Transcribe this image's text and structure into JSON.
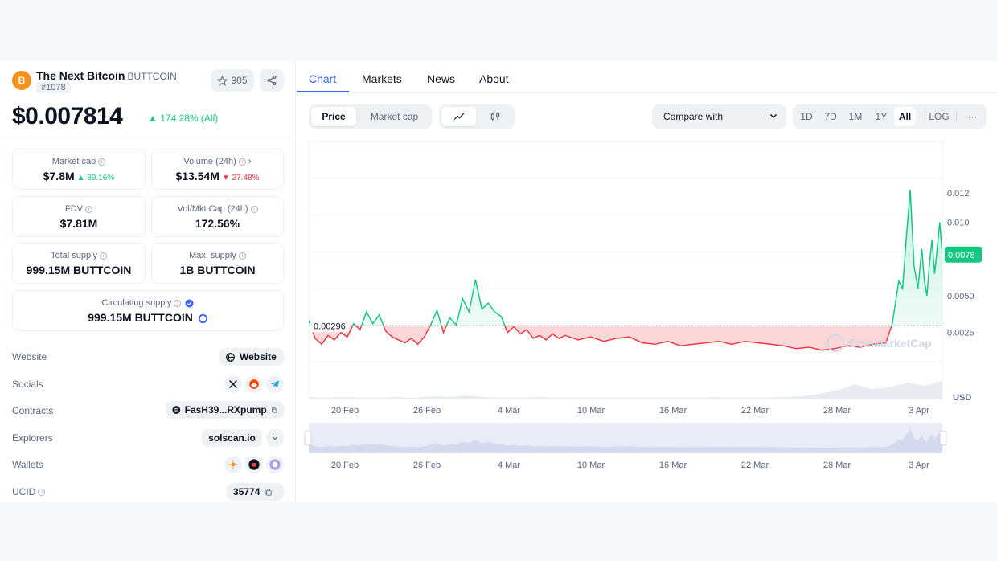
{
  "coin": {
    "name": "The Next Bitcoin",
    "symbol": "BUTTCOIN",
    "rank": "#1078",
    "watchlist_count": "905",
    "price": "$0.007814",
    "price_change": "174.28% (All)"
  },
  "stats": {
    "market_cap": {
      "label": "Market cap",
      "value": "$7.8M",
      "change": "89.16%"
    },
    "volume": {
      "label": "Volume (24h)",
      "value": "$13.54M",
      "change": "27.48%"
    },
    "fdv": {
      "label": "FDV",
      "value": "$7.81M"
    },
    "vol_mkt_cap": {
      "label": "Vol/Mkt Cap (24h)",
      "value": "172.56%"
    },
    "total_supply": {
      "label": "Total supply",
      "value": "999.15M BUTTCOIN"
    },
    "max_supply": {
      "label": "Max. supply",
      "value": "1B BUTTCOIN"
    },
    "circulating_supply": {
      "label": "Circulating supply",
      "value": "999.15M BUTTCOIN"
    }
  },
  "links": {
    "website_label": "Website",
    "website_button": "Website",
    "socials_label": "Socials",
    "contracts_label": "Contracts",
    "contract_value": "FasH39...RXpump",
    "explorers_label": "Explorers",
    "explorer_value": "solscan.io",
    "wallets_label": "Wallets",
    "ucid_label": "UCID",
    "ucid_value": "35774"
  },
  "tabs": [
    "Chart",
    "Markets",
    "News",
    "About"
  ],
  "controls": {
    "price_btn": "Price",
    "market_cap_btn": "Market cap",
    "compare_placeholder": "Compare with",
    "ranges": [
      "1D",
      "7D",
      "1M",
      "1Y",
      "All"
    ],
    "log_btn": "LOG",
    "more_btn": "···"
  },
  "chart_data": {
    "type": "line",
    "baseline": 0.00296,
    "baseline_label": "0.00296",
    "current_label": "0.0078",
    "currency_label": "USD",
    "watermark": "CoinMarketCap",
    "y_ticks": [
      0.0025,
      0.005,
      0.01,
      0.012
    ],
    "y_tick_labels": [
      "0.0025",
      "0.0050",
      "0.010",
      "0.012"
    ],
    "x_tick_labels": [
      "20 Feb",
      "26 Feb",
      "4 Mar",
      "10 Mar",
      "16 Mar",
      "22 Mar",
      "28 Mar",
      "3 Apr"
    ],
    "ylim": [
      -0.002,
      0.0155
    ],
    "colors": {
      "up": "#16c784",
      "down": "#ea3943"
    },
    "series": [
      {
        "x": [
          0,
          0.5,
          1,
          1.5,
          2,
          2.5,
          3,
          3.5,
          4,
          4.5,
          5,
          5.5,
          6,
          6.5,
          7,
          7.5,
          8,
          8.5,
          9,
          9.5,
          10,
          10.5,
          11,
          11.5,
          12,
          12.5,
          13,
          13.5,
          14,
          14.5,
          15,
          15.5,
          16,
          16.5,
          17,
          17.5,
          18,
          18.5,
          19,
          19.5,
          20,
          21,
          22,
          23,
          24,
          25,
          26,
          27,
          28,
          29,
          30,
          31,
          32,
          33,
          34,
          35,
          36,
          37,
          38,
          39,
          40,
          41,
          42,
          43,
          44,
          45,
          45.5,
          46,
          46.3,
          46.6,
          46.9,
          47.2,
          47.5,
          47.8,
          48,
          48.2,
          48.4,
          48.6,
          48.8,
          49,
          49.2,
          49.4
        ],
        "values": [
          0.0033,
          0.0021,
          0.0017,
          0.0023,
          0.002,
          0.0025,
          0.0022,
          0.0031,
          0.0027,
          0.0039,
          0.0031,
          0.0037,
          0.0026,
          0.0022,
          0.002,
          0.0018,
          0.0021,
          0.0017,
          0.0022,
          0.003,
          0.004,
          0.0025,
          0.0035,
          0.003,
          0.0048,
          0.0039,
          0.0061,
          0.0041,
          0.0045,
          0.0039,
          0.0036,
          0.0025,
          0.0029,
          0.0024,
          0.0027,
          0.0021,
          0.0023,
          0.002,
          0.0024,
          0.0021,
          0.0023,
          0.002,
          0.0022,
          0.0019,
          0.0021,
          0.0022,
          0.0018,
          0.0017,
          0.0019,
          0.0016,
          0.0017,
          0.0018,
          0.0019,
          0.0017,
          0.0019,
          0.0018,
          0.0017,
          0.0016,
          0.0014,
          0.0015,
          0.0013,
          0.0014,
          0.0016,
          0.0015,
          0.0017,
          0.0018,
          0.0031,
          0.006,
          0.0055,
          0.009,
          0.0122,
          0.007,
          0.0055,
          0.0082,
          0.006,
          0.005,
          0.0072,
          0.0088,
          0.0065,
          0.0082,
          0.01,
          0.0078
        ]
      }
    ]
  }
}
